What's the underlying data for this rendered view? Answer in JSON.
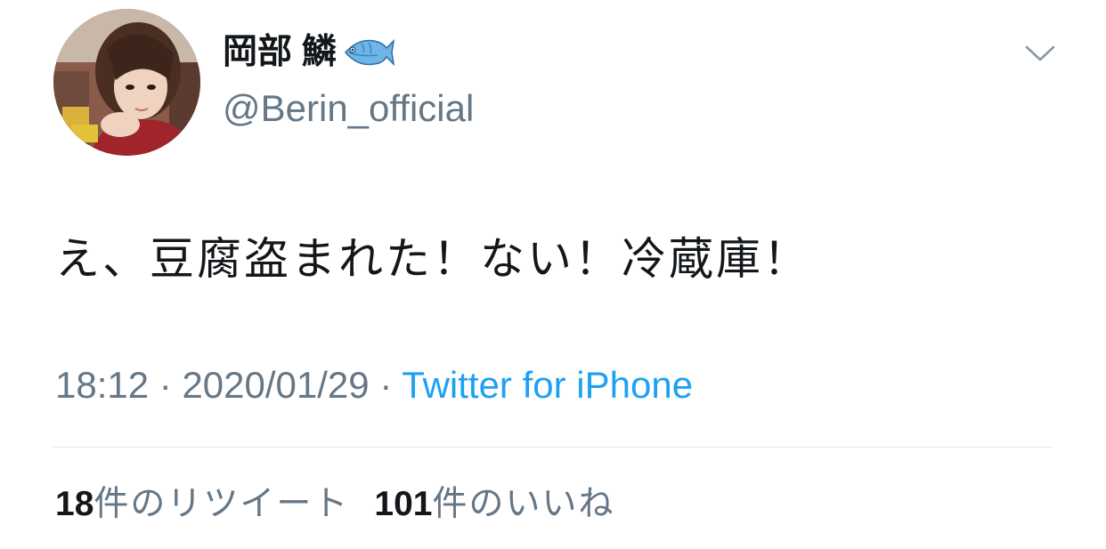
{
  "author": {
    "display_name": "岡部 鱗",
    "name_emoji": "fish-emoji",
    "handle": "@Berin_official",
    "avatar": "profile-photo"
  },
  "tweet": {
    "text": "え、豆腐盗まれた！ない！冷蔵庫！",
    "time": "18:12",
    "separator": " · ",
    "date": "2020/01/29",
    "source": "Twitter for iPhone"
  },
  "stats": {
    "retweets_count": "18",
    "retweets_label": "件のリツイート",
    "likes_count": "101",
    "likes_label": "件のいいね"
  },
  "icons": {
    "menu": "chevron-down-icon",
    "emoji": "fish-icon"
  },
  "colors": {
    "text": "#14171a",
    "secondary": "#657786",
    "link": "#1da1f2",
    "divider": "#e1e8ed"
  }
}
